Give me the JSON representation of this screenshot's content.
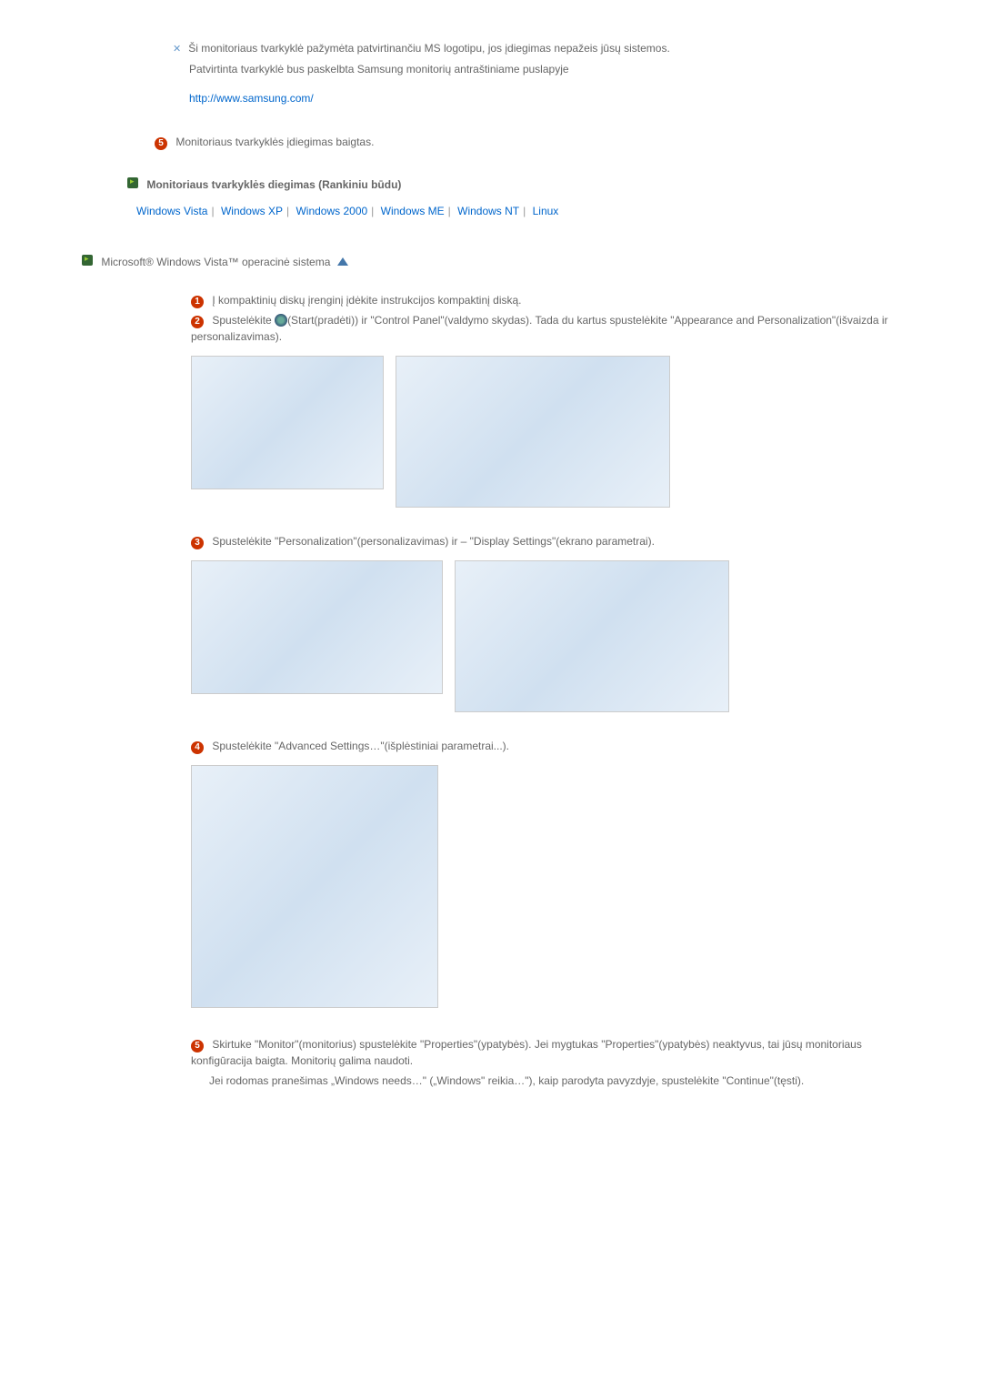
{
  "note": {
    "line1": "Ši monitoriaus tvarkyklė pažymėta patvirtinančiu MS logotipu, jos įdiegimas nepažeis jūsų sistemos.",
    "line2": "Patvirtinta tvarkyklė bus paskelbta Samsung monitorių antraštiniame puslapyje",
    "url": "http://www.samsung.com/"
  },
  "step5_top": "Monitoriaus tvarkyklės įdiegimas baigtas.",
  "section_header": "Monitoriaus tvarkyklės diegimas (Rankiniu būdu)",
  "os_links": {
    "vista": "Windows Vista",
    "xp": "Windows XP",
    "w2000": "Windows 2000",
    "me": "Windows ME",
    "nt": "Windows NT",
    "linux": "Linux"
  },
  "vista_title": "Microsoft® Windows Vista™ operacinė sistema",
  "steps": {
    "s1": "Į kompaktinių diskų įrenginį įdėkite instrukcijos kompaktinį diską.",
    "s2a": "Spustelėkite ",
    "s2b": "(Start(pradėti)) ir \"Control Panel\"(valdymo skydas). Tada du kartus spustelėkite \"Appearance and Personalization\"(išvaizda ir personalizavimas).",
    "s3": "Spustelėkite \"Personalization\"(personalizavimas) ir – \"Display Settings\"(ekrano parametrai).",
    "s4": "Spustelėkite \"Advanced Settings…\"(išplėstiniai parametrai...).",
    "s5a": "Skirtuke \"Monitor\"(monitorius) spustelėkite \"Properties\"(ypatybės). Jei mygtukas \"Properties\"(ypatybės) neaktyvus, tai jūsų monitoriaus konfigūracija baigta. Monitorių galima naudoti.",
    "s5b": "Jei rodomas pranešimas „Windows needs…\" („Windows\" reikia…\"), kaip parodyta pavyzdyje, spustelėkite \"Continue\"(tęsti)."
  },
  "bullets": {
    "b1": "1",
    "b2": "2",
    "b3": "3",
    "b4": "4",
    "b5": "5"
  }
}
